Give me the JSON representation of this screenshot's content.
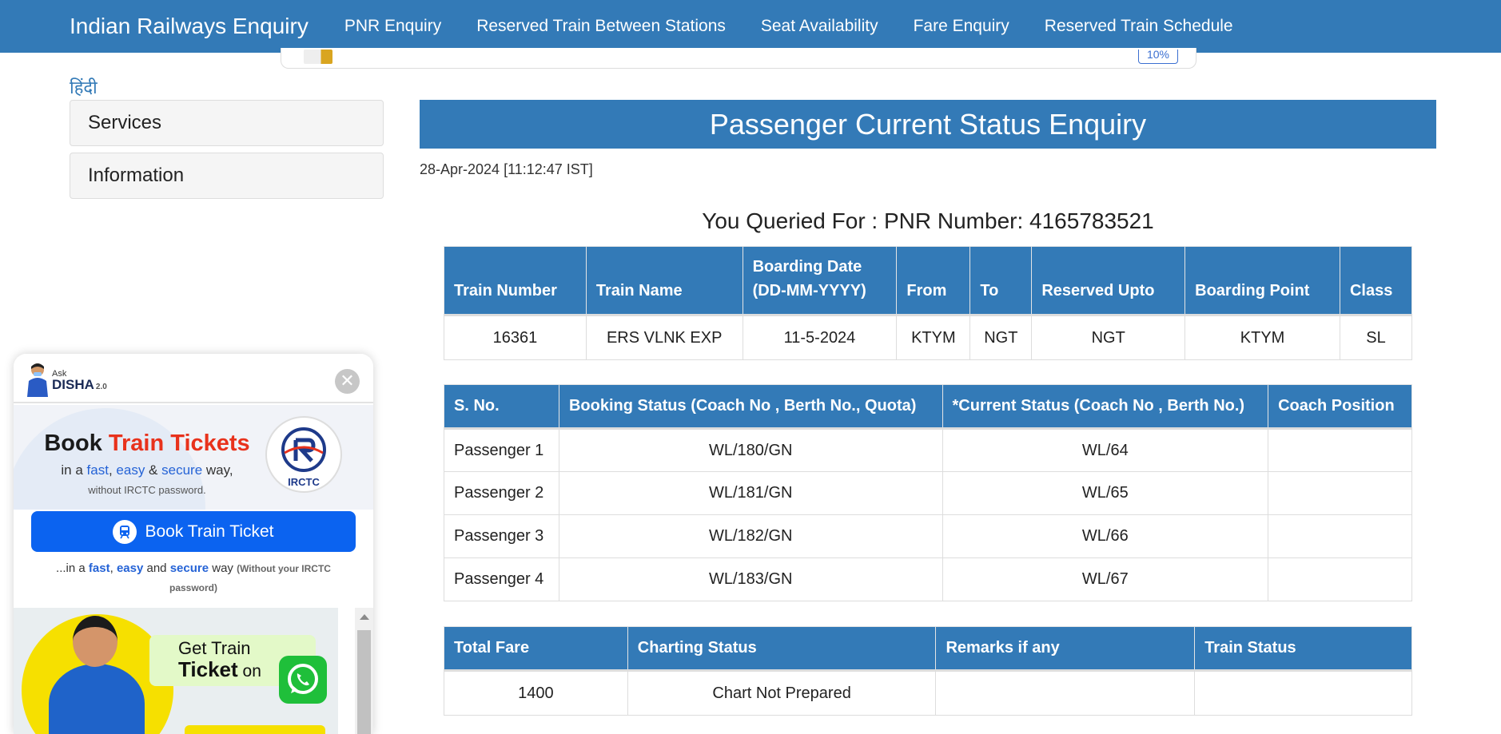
{
  "navbar": {
    "brand": "Indian Railways Enquiry",
    "links": [
      "PNR Enquiry",
      "Reserved Train Between Stations",
      "Seat Availability",
      "Fare Enquiry",
      "Reserved Train Schedule"
    ]
  },
  "ad": {
    "badge": "10%"
  },
  "sidebar": {
    "language_link": "हिंदी",
    "panels": [
      "Services",
      "Information"
    ]
  },
  "main": {
    "title": "Passenger Current Status Enquiry",
    "timestamp": "28-Apr-2024 [11:12:47 IST]",
    "queried": "You Queried For : PNR Number: 4165783521",
    "train_table": {
      "headers": [
        "Train Number",
        "Train Name",
        "Boarding Date\n(DD-MM-YYYY)",
        "From",
        "To",
        "Reserved Upto",
        "Boarding Point",
        "Class"
      ],
      "row": [
        "16361",
        "ERS VLNK EXP",
        "11-5-2024",
        "KTYM",
        "NGT",
        "NGT",
        "KTYM",
        "SL"
      ]
    },
    "passenger_table": {
      "headers": [
        "S. No.",
        "Booking Status (Coach No , Berth No., Quota)",
        "*Current Status (Coach No , Berth No.)",
        "Coach Position"
      ],
      "rows": [
        [
          "Passenger 1",
          "WL/180/GN",
          "WL/64",
          ""
        ],
        [
          "Passenger 2",
          "WL/181/GN",
          "WL/65",
          ""
        ],
        [
          "Passenger 3",
          "WL/182/GN",
          "WL/66",
          ""
        ],
        [
          "Passenger 4",
          "WL/183/GN",
          "WL/67",
          ""
        ]
      ]
    },
    "fare_table": {
      "headers": [
        "Total Fare",
        "Charting Status",
        "Remarks if any",
        "Train Status"
      ],
      "row": [
        "1400",
        "Chart Not Prepared",
        "",
        ""
      ]
    }
  },
  "disha": {
    "ask": "Ask",
    "name": "DISHA",
    "version": "2.0",
    "close_glyph": "✕",
    "promo_title_a": "Book ",
    "promo_title_b": "Train Tickets",
    "promo_sub": [
      "in a ",
      "fast",
      ", ",
      "easy",
      " & ",
      "secure",
      " way,"
    ],
    "promo_note": "without IRCTC password.",
    "irctc": "IRCTC",
    "book_button": "Book Train Ticket",
    "book_note": [
      "...in a ",
      "fast",
      ", ",
      "easy",
      " and ",
      "secure",
      " way ",
      "(Without your IRCTC password)"
    ],
    "wa_line1": "Get Train",
    "wa_line2": "Ticket",
    "wa_line2_suffix": " on"
  },
  "colors": {
    "primary": "#337ab7",
    "disha_button": "#0b63f0",
    "whatsapp": "#1fbf3a"
  }
}
